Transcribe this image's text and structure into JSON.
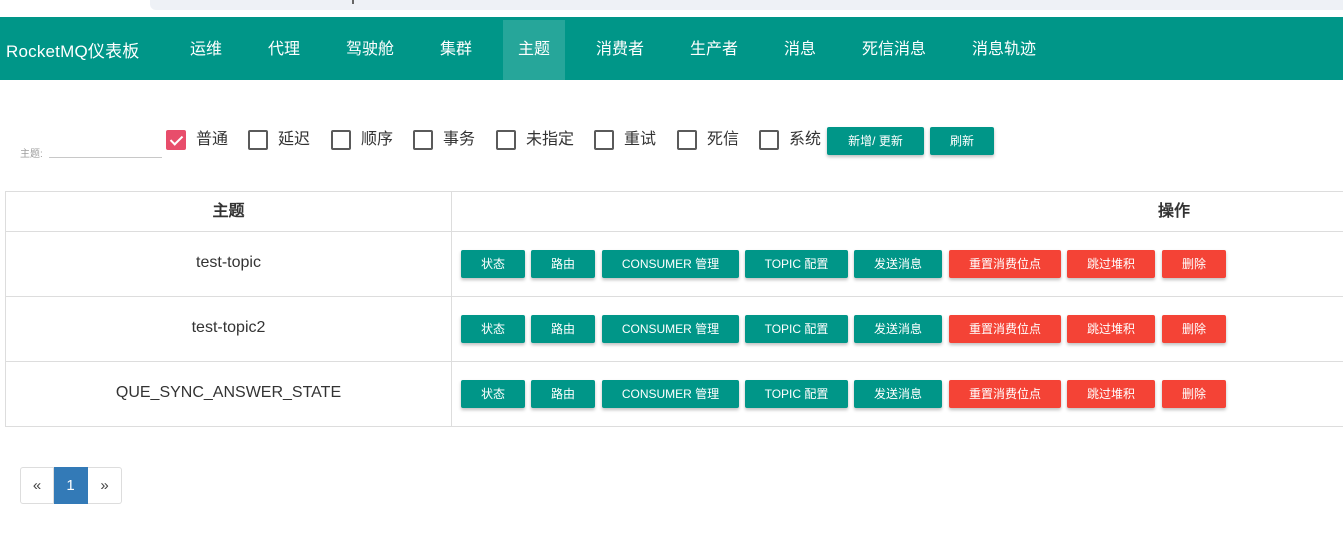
{
  "brand": "RocketMQ仪表板",
  "nav": [
    "运维",
    "代理",
    "驾驶舱",
    "集群",
    "主题",
    "消费者",
    "生产者",
    "消息",
    "死信消息",
    "消息轨迹"
  ],
  "nav_active": "主题",
  "filter": {
    "label": "主题:",
    "value": "",
    "placeholder": ""
  },
  "checkboxes": [
    {
      "label": "普通",
      "checked": true
    },
    {
      "label": "延迟",
      "checked": false
    },
    {
      "label": "顺序",
      "checked": false
    },
    {
      "label": "事务",
      "checked": false
    },
    {
      "label": "未指定",
      "checked": false
    },
    {
      "label": "重试",
      "checked": false
    },
    {
      "label": "死信",
      "checked": false
    },
    {
      "label": "系统",
      "checked": false
    }
  ],
  "toolbar": {
    "add_update": "新增/ 更新",
    "refresh": "刷新"
  },
  "table": {
    "headers": [
      "主题",
      "操作"
    ],
    "rows": [
      {
        "topic": "test-topic"
      },
      {
        "topic": "test-topic2"
      },
      {
        "topic": "QUE_SYNC_ANSWER_STATE"
      }
    ],
    "actions": [
      "状态",
      "路由",
      "CONSUMER 管理",
      "TOPIC 配置",
      "发送消息",
      "重置消费位点",
      "跳过堆积",
      "删除"
    ]
  },
  "pagination": {
    "prev": "«",
    "current": "1",
    "next": "»"
  },
  "colors": {
    "primary": "#009688",
    "danger": "#f44336",
    "checkbox": "#e84d6b",
    "page_active": "#337ab7"
  }
}
